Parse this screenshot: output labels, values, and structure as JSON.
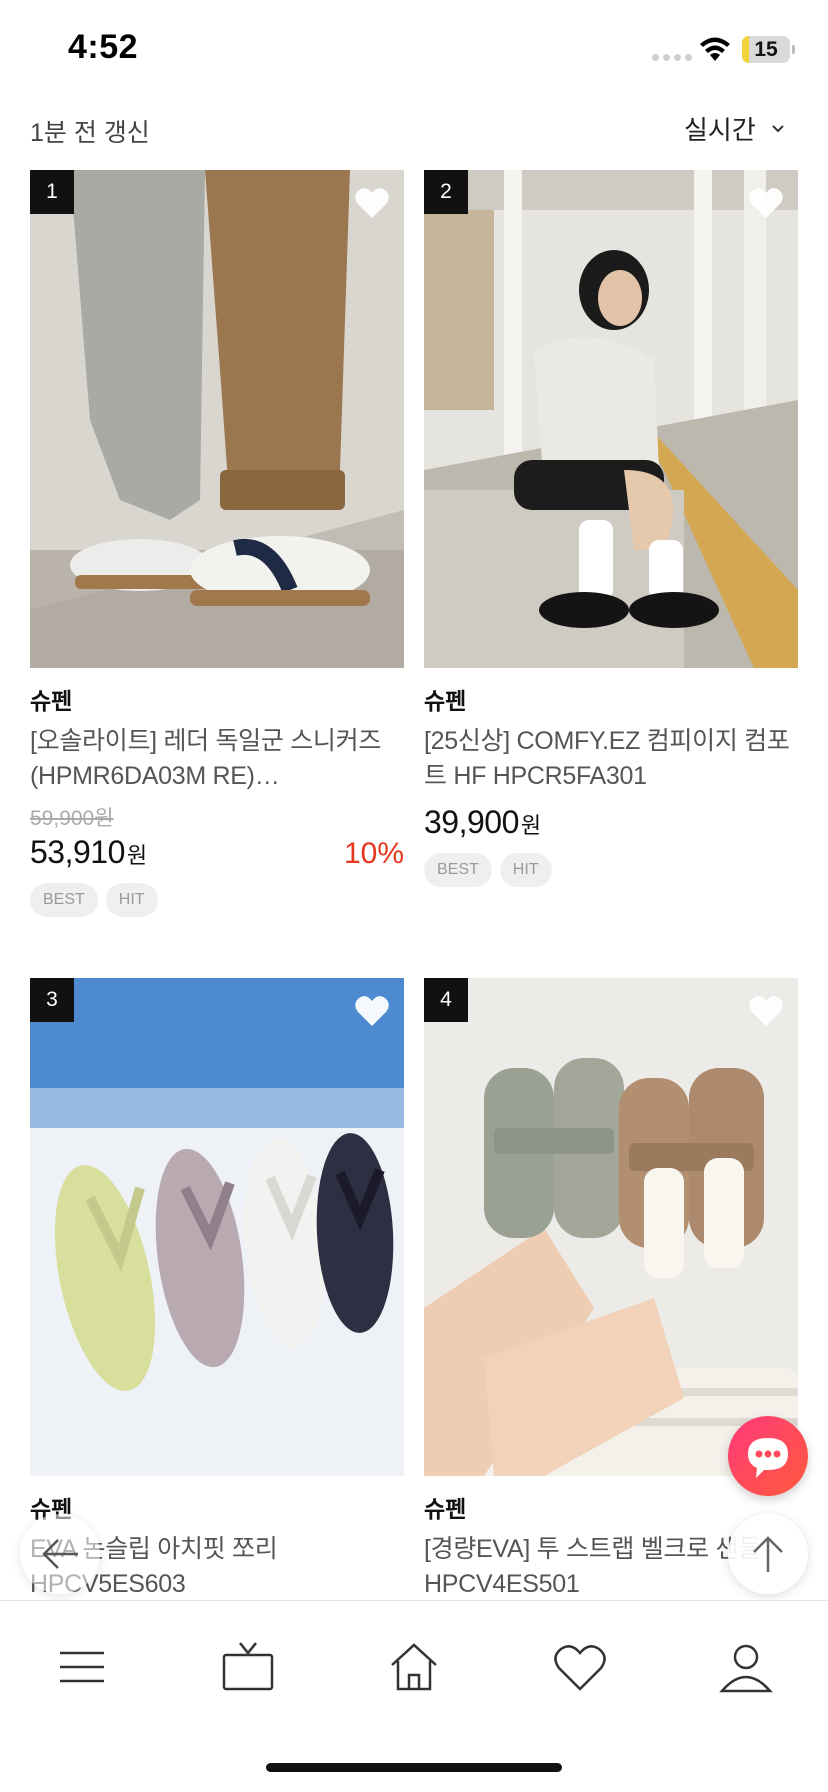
{
  "status_bar": {
    "time": "4:52",
    "battery": "15",
    "battery_level": 0.15
  },
  "header": {
    "refresh_text": "1분 전 갱신",
    "sort_label": "실시간"
  },
  "products": [
    {
      "rank": "1",
      "brand": "슈펜",
      "name": "[오솔라이트] 레더 독일군 스니커즈 (HPMR6DA03M RE)…",
      "original_price": "59,900원",
      "price": "53,910",
      "currency": "원",
      "discount": "10%",
      "tags": [
        "BEST",
        "HIT"
      ]
    },
    {
      "rank": "2",
      "brand": "슈펜",
      "name": "[25신상] COMFY.EZ 컴피이지 컴포트 HF HPCR5FA301",
      "price": "39,900",
      "currency": "원",
      "tags": [
        "BEST",
        "HIT"
      ]
    },
    {
      "rank": "3",
      "brand": "슈펜",
      "name": "EVA 논슬립 아치핏 쪼리 HPCV5ES603"
    },
    {
      "rank": "4",
      "brand": "슈펜",
      "name": "[경량EVA] 투 스트랩 벨크로 샌들 HPCV4ES501"
    }
  ],
  "bottom_nav": [
    "menu-icon",
    "tv-icon",
    "home-icon",
    "heart-icon",
    "profile-icon"
  ],
  "colors": {
    "discount": "#e8361e",
    "chat_gradient_start": "#ff3a7a",
    "chat_gradient_end": "#ff5a3c"
  }
}
